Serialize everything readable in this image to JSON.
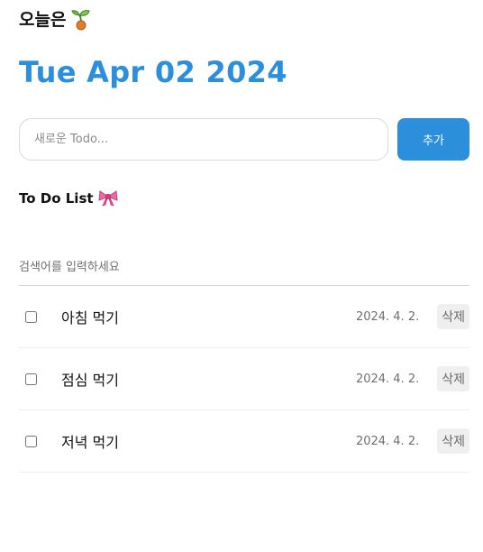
{
  "header": {
    "title": "오늘은",
    "icon": "sprout-icon",
    "date": "Tue Apr 02 2024"
  },
  "colors": {
    "accent": "#2b8fdb",
    "border": "#d9d9d9",
    "delete_bg": "#efefef"
  },
  "editor": {
    "placeholder": "새로운 Todo...",
    "value": "",
    "add_label": "추가"
  },
  "list": {
    "title": "To Do List",
    "title_icon": "ribbon-icon",
    "search_placeholder": "검색어를 입력하세요",
    "items": [
      {
        "content": "아침 먹기",
        "date": "2024. 4. 2.",
        "delete_label": "삭제",
        "done": false
      },
      {
        "content": "점심 먹기",
        "date": "2024. 4. 2.",
        "delete_label": "삭제",
        "done": false
      },
      {
        "content": "저녁 먹기",
        "date": "2024. 4. 2.",
        "delete_label": "삭제",
        "done": false
      }
    ]
  }
}
